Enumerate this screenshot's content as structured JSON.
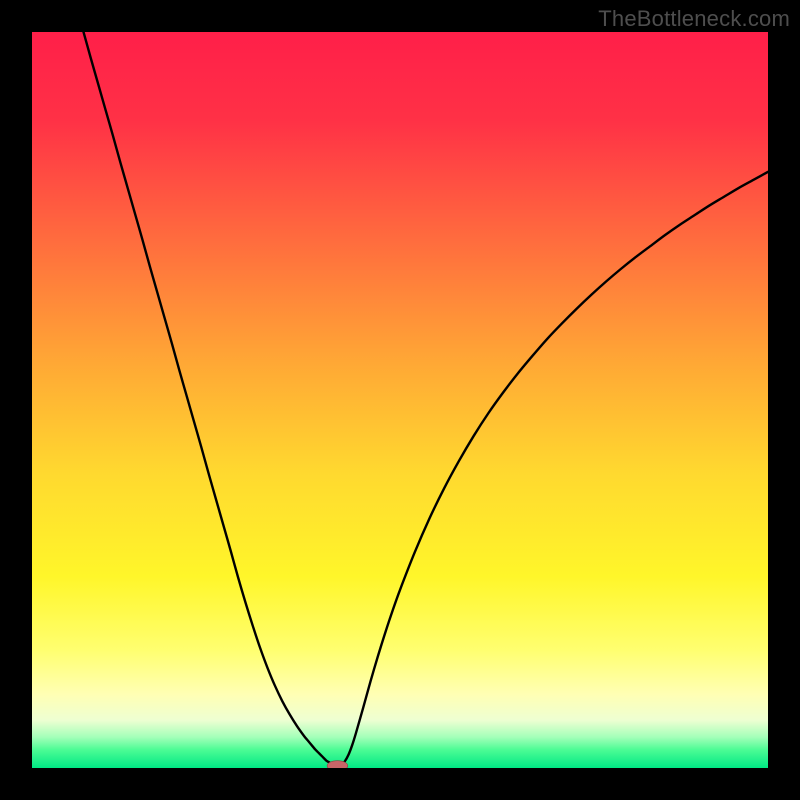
{
  "watermark": "TheBottleneck.com",
  "colors": {
    "black": "#000000",
    "curve": "#000000",
    "marker_fill": "#c86568",
    "gradient_stops": [
      {
        "offset": 0.0,
        "color": "#ff1f49"
      },
      {
        "offset": 0.12,
        "color": "#ff3146"
      },
      {
        "offset": 0.28,
        "color": "#ff6b3e"
      },
      {
        "offset": 0.45,
        "color": "#ffa835"
      },
      {
        "offset": 0.6,
        "color": "#ffd92f"
      },
      {
        "offset": 0.74,
        "color": "#fff62a"
      },
      {
        "offset": 0.84,
        "color": "#ffff70"
      },
      {
        "offset": 0.9,
        "color": "#ffffb4"
      },
      {
        "offset": 0.935,
        "color": "#eeffd2"
      },
      {
        "offset": 0.958,
        "color": "#a4ffb9"
      },
      {
        "offset": 0.975,
        "color": "#4dfc95"
      },
      {
        "offset": 1.0,
        "color": "#00e884"
      }
    ]
  },
  "chart_data": {
    "type": "line",
    "title": "",
    "xlabel": "",
    "ylabel": "",
    "xlim": [
      0,
      100
    ],
    "ylim": [
      0,
      100
    ],
    "grid": false,
    "legend": false,
    "x": [
      7,
      8,
      9,
      10,
      11,
      12,
      13,
      14,
      15,
      16,
      17,
      18,
      19,
      20,
      21,
      22,
      23,
      24,
      25,
      26,
      27,
      28,
      29,
      30,
      31,
      32,
      33,
      34,
      35,
      36,
      37,
      37.5,
      38,
      38.5,
      39,
      39.5,
      40,
      40.5,
      41,
      41.5,
      42,
      42.5,
      43,
      43.5,
      44,
      45,
      46,
      47,
      48,
      49,
      50,
      52,
      54,
      56,
      58,
      60,
      62,
      64,
      66,
      68,
      70,
      72,
      74,
      76,
      78,
      80,
      82,
      84,
      86,
      88,
      90,
      92,
      94,
      96,
      98,
      100
    ],
    "values": [
      100.0,
      96.4,
      92.9,
      89.4,
      85.9,
      82.3,
      78.8,
      75.3,
      71.8,
      68.2,
      64.7,
      61.2,
      57.7,
      54.1,
      50.6,
      47.1,
      43.6,
      40.0,
      36.5,
      33.0,
      29.5,
      25.9,
      22.5,
      19.3,
      16.3,
      13.6,
      11.2,
      9.1,
      7.3,
      5.7,
      4.3,
      3.7,
      3.1,
      2.5,
      2.0,
      1.5,
      1.0,
      0.7,
      0.4,
      0.25,
      0.35,
      0.9,
      1.8,
      3.1,
      4.7,
      8.2,
      11.8,
      15.2,
      18.4,
      21.4,
      24.2,
      29.3,
      33.9,
      38.0,
      41.7,
      45.1,
      48.2,
      51.0,
      53.6,
      56.0,
      58.3,
      60.4,
      62.4,
      64.3,
      66.1,
      67.8,
      69.4,
      70.9,
      72.4,
      73.8,
      75.1,
      76.4,
      77.6,
      78.8,
      79.9,
      81.0
    ],
    "marker": {
      "x": 41.5,
      "y": 0.3,
      "rx": 1.4,
      "ry": 0.7
    }
  }
}
